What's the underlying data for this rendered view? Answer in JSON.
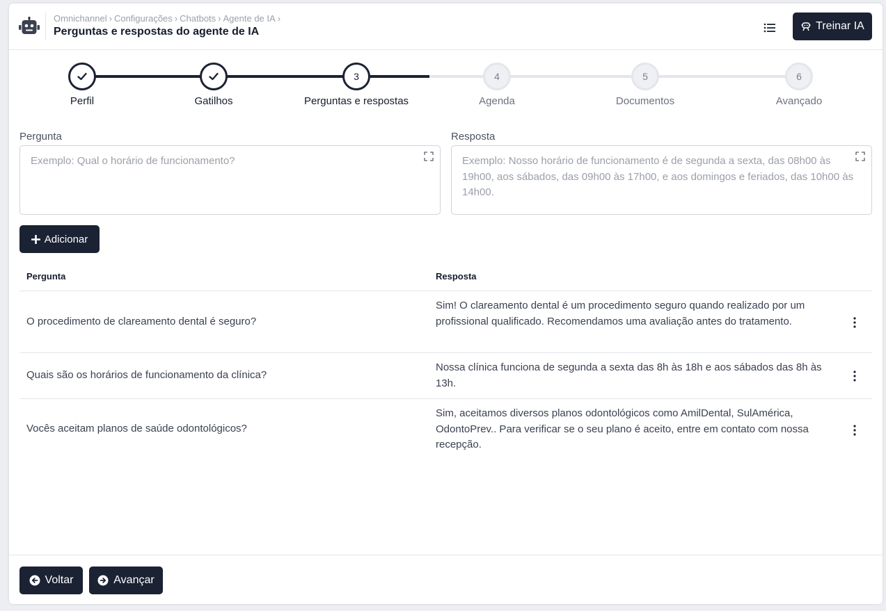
{
  "header": {
    "breadcrumb": [
      "Omnichannel",
      "Configurações",
      "Chatbots",
      "Agente de IA"
    ],
    "title": "Perguntas e respostas do agente de IA",
    "train_label": "Treinar IA"
  },
  "stepper": {
    "steps": [
      {
        "number": "1",
        "label": "Perfil",
        "state": "done"
      },
      {
        "number": "2",
        "label": "Gatilhos",
        "state": "done"
      },
      {
        "number": "3",
        "label": "Perguntas e respostas",
        "state": "current"
      },
      {
        "number": "4",
        "label": "Agenda",
        "state": "todo"
      },
      {
        "number": "5",
        "label": "Documentos",
        "state": "todo"
      },
      {
        "number": "6",
        "label": "Avançado",
        "state": "todo"
      }
    ]
  },
  "form": {
    "question_label": "Pergunta",
    "question_placeholder": "Exemplo: Qual o horário de funcionamento?",
    "answer_label": "Resposta",
    "answer_placeholder": "Exemplo: Nosso horário de funcionamento é de segunda a sexta, das 08h00 às 19h00, aos sábados, das 09h00 às 17h00, e aos domingos e feriados, das 10h00 às 14h00.",
    "add_label": "Adicionar"
  },
  "table": {
    "headers": {
      "question": "Pergunta",
      "answer": "Resposta"
    },
    "rows": [
      {
        "question": "O procedimento de clareamento dental é seguro?",
        "answer": "Sim! O clareamento dental é um procedimento seguro quando realizado por um profissional qualificado. Recomendamos uma avaliação antes do tratamento."
      },
      {
        "question": "Quais são os horários de funcionamento da clínica?",
        "answer": "Nossa clínica funciona de segunda a sexta das 8h às 18h e aos sábados das 8h às 13h."
      },
      {
        "question": "Vocês aceitam planos de saúde odontológicos?",
        "answer": "Sim, aceitamos diversos planos odontológicos como AmilDental, SulAmérica, OdontoPrev.. Para verificar se o seu plano é aceito, entre em contato com nossa recepção."
      }
    ]
  },
  "footer": {
    "back_label": "Voltar",
    "next_label": "Avançar"
  },
  "colors": {
    "primary": "#1b2233",
    "step_inactive": "#e3e6ea",
    "placeholder": "#9a9fa8"
  }
}
